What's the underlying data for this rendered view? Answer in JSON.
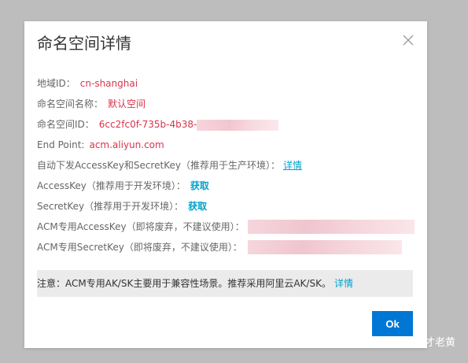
{
  "dialog": {
    "title": "命名空间详情",
    "close_icon": "close-icon"
  },
  "details": {
    "region_label": "地域ID：",
    "region_value": "cn-shanghai",
    "ns_name_label": "命名空间名称：",
    "ns_name_value": "默认空间",
    "ns_id_label": "命名空间ID：",
    "ns_id_value": "6cc2fc0f-735b-4b38-",
    "endpoint_label": "End Point:",
    "endpoint_value": "acm.aliyun.com",
    "auto_key_label": "自动下发AccessKey和SecretKey（推荐用于生产环境）：",
    "auto_key_link": "详情",
    "access_key_label": "AccessKey（推荐用于开发环境）：",
    "access_key_action": "获取",
    "secret_key_label": "SecretKey（推荐用于开发环境）：",
    "secret_key_action": "获取",
    "acm_access_key_label": "ACM专用AccessKey（即将废弃，不建议使用）：",
    "acm_secret_key_label": "ACM专用SecretKey（即将废弃，不建议使用）："
  },
  "notice": {
    "text": "注意：ACM专用AK/SK主要用于兼容性场景。推荐采用阿里云AK/SK。",
    "link": "详情"
  },
  "footer": {
    "ok_label": "Ok"
  },
  "watermark": {
    "text": "不才老黄",
    "icon": "wechat-icon"
  },
  "colors": {
    "value_red": "#d9344c",
    "link_blue": "#00a2ca",
    "primary_button": "#0077d4",
    "notice_bg": "#ebebeb",
    "backdrop": "#bdbdbd"
  }
}
